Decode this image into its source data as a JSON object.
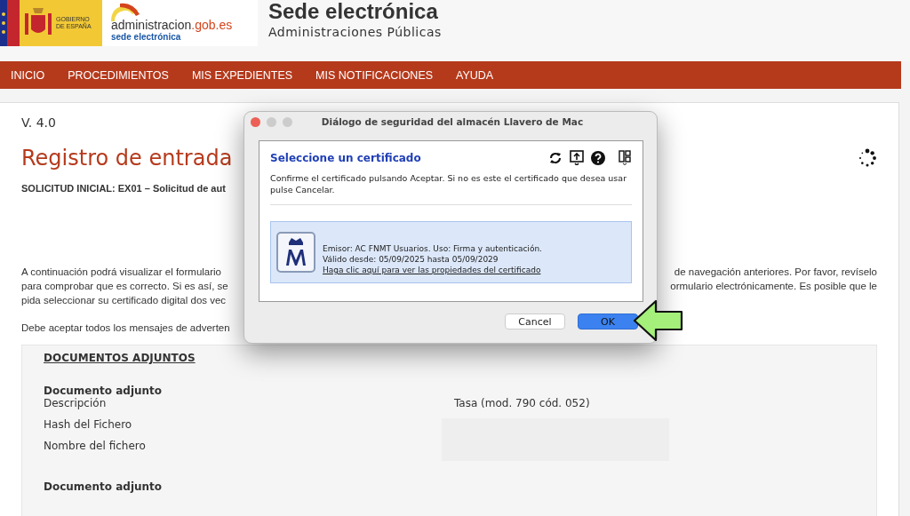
{
  "header": {
    "gov_logo_text": "GOBIERNO DE ESPAÑA",
    "site_logo_main": "administracion",
    "site_logo_domain": ".gob.es",
    "site_logo_sub": "sede electrónica",
    "title": "Sede electrónica",
    "subtitle": "Administraciones Públicas"
  },
  "nav": [
    {
      "label": "INICIO"
    },
    {
      "label": "PROCEDIMIENTOS"
    },
    {
      "label": "MIS EXPEDIENTES"
    },
    {
      "label": "MIS NOTIFICACIONES"
    },
    {
      "label": "AYUDA"
    }
  ],
  "page": {
    "version": "V. 4.0",
    "heading": "Registro de entrada",
    "request": "SOLICITUD INICIAL: EX01 – Solicitud de aut",
    "paragraph_lines": [
      {
        "left": "A continuación podrá visualizar el formulario",
        "right": "de navegación anteriores. Por favor, revíselo"
      },
      {
        "left": "para comprobar que es correcto. Si es así, se",
        "right": "ormulario electrónicamente. Es posible que le"
      },
      {
        "left": "pida seleccionar su certificado digital dos vec"
      }
    ],
    "notice": "Debe aceptar todos los mensajes de adverten",
    "section_title": "DOCUMENTOS ADJUNTOS",
    "documents": [
      {
        "title": "Documento adjunto",
        "fields": [
          {
            "label": "Descripción",
            "value": "Tasa (mod. 790 cód. 052)"
          },
          {
            "label": "Hash del Fichero"
          },
          {
            "label": "Nombre del fichero"
          }
        ]
      },
      {
        "title": "Documento adjunto"
      }
    ]
  },
  "dialog": {
    "title": "Diálogo de seguridad del almacén Llavero de Mac",
    "heading": "Seleccione un certificado",
    "message": "Confirme el certificado pulsando Aceptar. Si no es este el certificado que desea usar pulse Cancelar.",
    "certificate": {
      "issuer": "Emisor: AC FNMT Usuarios. Uso: Firma y autenticación.",
      "validity": "Válido desde: 05/09/2025 hasta 05/09/2029",
      "link": "Haga clic aquí para ver las propiedades del certificado",
      "selected": true
    },
    "buttons": [
      {
        "label": "Cancel",
        "kind": "secondary"
      },
      {
        "label": "OK",
        "kind": "primary"
      }
    ]
  }
}
